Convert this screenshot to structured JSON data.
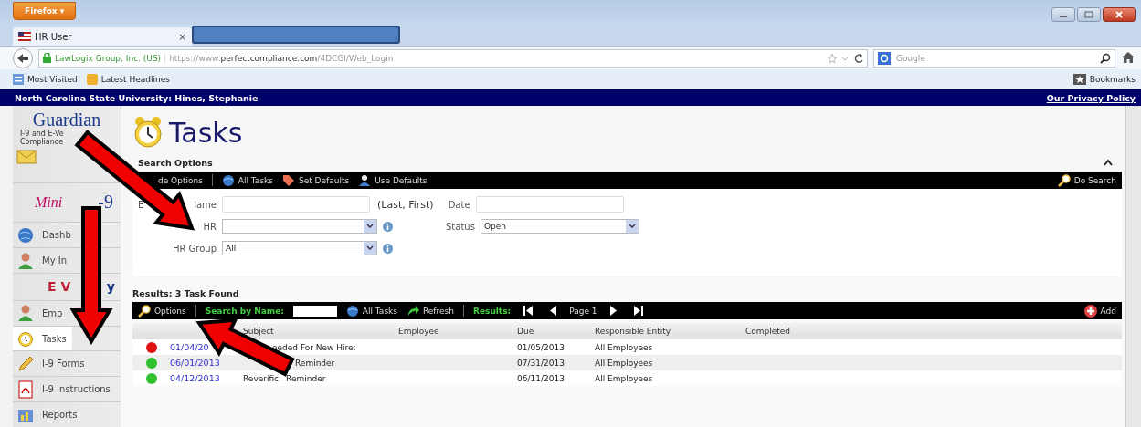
{
  "browser": {
    "menu_button": "Firefox ▾",
    "tab_title": "HR User",
    "tab_close": "×",
    "identity": "LawLogix Group, Inc. (US)",
    "url_prefix": "https://www.",
    "url_domain": "perfectcompliance.com",
    "url_path": "/4DCGI/Web_Login",
    "search_placeholder": "Google",
    "bookmarks": [
      "Most Visited",
      "Latest Headlines"
    ],
    "bookmarks_button": "Bookmarks"
  },
  "header": {
    "user": "North Carolina State University: Hines, Stephanie",
    "privacy_link": "Our Privacy Policy"
  },
  "sidebar": {
    "brand": "Guardian",
    "tagline_lines": [
      "I-9 and E-Ve",
      "Compliance"
    ],
    "logo_minute": [
      "Mini",
      "-9"
    ],
    "logo_everify": [
      "E V",
      "y"
    ],
    "items": [
      {
        "kind": "link",
        "label": "Dashb",
        "selected": false
      },
      {
        "kind": "link",
        "label": "My In",
        "selected": false
      },
      {
        "kind": "logo"
      },
      {
        "kind": "link",
        "label": "Emp",
        "selected": false
      },
      {
        "kind": "link",
        "label": "Tasks",
        "selected": true
      },
      {
        "kind": "link",
        "label": "I-9 Forms",
        "selected": false
      },
      {
        "kind": "link",
        "label": "I-9 Instructions",
        "selected": false
      },
      {
        "kind": "link",
        "label": "Reports",
        "selected": false
      }
    ]
  },
  "page": {
    "title": "Tasks",
    "search_options_title": "Search Options",
    "search_toolbar": [
      "de Options",
      "All Tasks",
      "Set Defaults",
      "Use Defaults"
    ],
    "do_search": "Do Search",
    "employee_label": [
      "E",
      "lame"
    ],
    "name_hint": "(Last, First)",
    "date_label": "Date",
    "hr_label": "HR",
    "status_label": "Status",
    "status_value": "Open",
    "hr_group_label": "HR Group",
    "hr_group_value": "All"
  },
  "results": {
    "title": "Results: 3 Task Found",
    "options": "Options",
    "search_by_name": "Search by Name:",
    "all_tasks": "All Tasks",
    "refresh": "Refresh",
    "results_label": "Results:",
    "page": "Page 1",
    "add": "Add",
    "columns": [
      "Subject",
      "Employee",
      "Due",
      "Responsible Entity",
      "Completed"
    ],
    "rows": [
      {
        "color": "#e01010",
        "date": "01/04/20",
        "subject": [
          "eeded For New Hire:"
        ],
        "due": "01/05/2013",
        "entity": "All Employees"
      },
      {
        "color": "#30c030",
        "date": "06/01/2013",
        "subject": [
          "Reminder"
        ],
        "due": "07/31/2013",
        "entity": "All Employees"
      },
      {
        "color": "#30c030",
        "date": "04/12/2013",
        "subject": [
          "Reverific",
          "Reminder"
        ],
        "due": "06/11/2013",
        "entity": "All Employees"
      }
    ]
  }
}
